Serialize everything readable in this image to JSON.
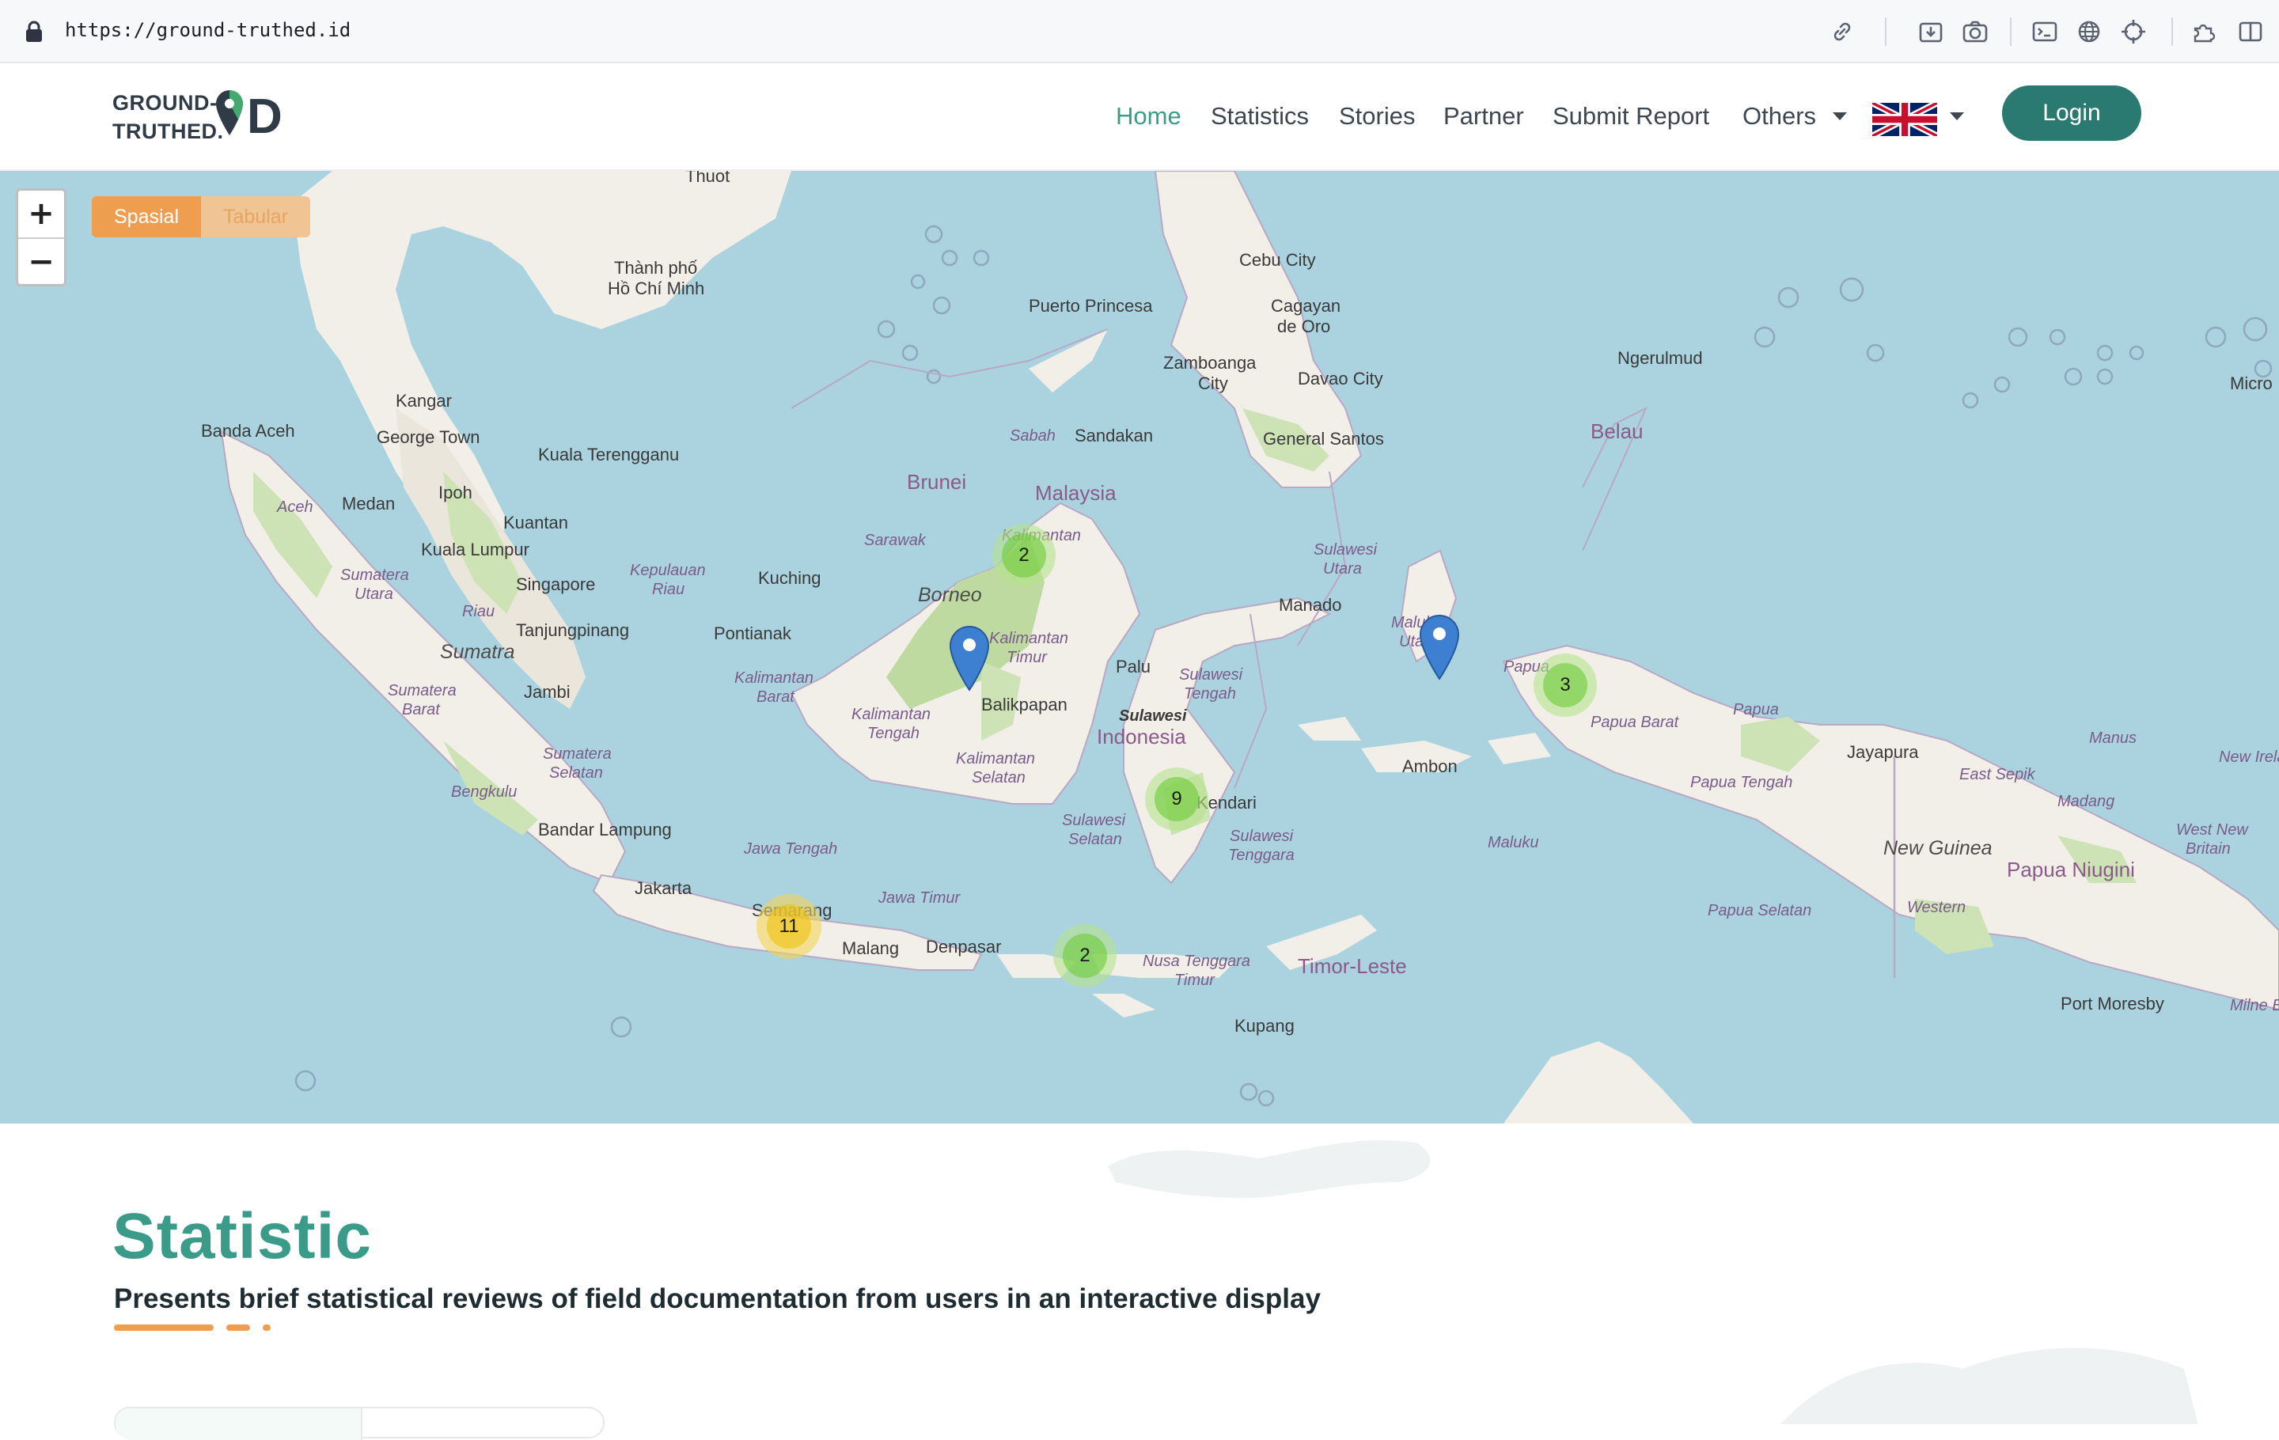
{
  "browser": {
    "url": "https://ground-truthed.id"
  },
  "site": {
    "logo_line1": "GROUND-",
    "logo_line2": "TRUTHED.",
    "logo_mark": "D"
  },
  "nav": {
    "items": [
      {
        "label": "Home",
        "active": true
      },
      {
        "label": "Statistics"
      },
      {
        "label": "Stories"
      },
      {
        "label": "Partner"
      },
      {
        "label": "Submit Report"
      },
      {
        "label": "Others"
      }
    ],
    "language": "English (UK flag)",
    "login_label": "Login"
  },
  "map": {
    "zoom_in": "+",
    "zoom_out": "−",
    "view_toggle": {
      "active": "Spasial",
      "inactive": "Tabular"
    },
    "clusters": [
      {
        "count": "2",
        "color": "green"
      },
      {
        "count": "3",
        "color": "green"
      },
      {
        "count": "9",
        "color": "green"
      },
      {
        "count": "11",
        "color": "yellow"
      },
      {
        "count": "2",
        "color": "green"
      }
    ],
    "labels": {
      "thuot": "Thuot",
      "hcmc1": "Thành phố",
      "hcmc2": "Hồ Chí Minh",
      "cebu": "Cebu City",
      "cagayan1": "Cagayan",
      "cagayan2": "de Oro",
      "puerto": "Puerto Princesa",
      "zamboanga1": "Zamboanga",
      "zamboanga2": "City",
      "davao": "Davao City",
      "gensan": "General Santos",
      "ngerulmud": "Ngerulmud",
      "belau": "Belau",
      "micro": "Micro",
      "banda": "Banda Aceh",
      "kangar": "Kangar",
      "georgetown": "George Town",
      "kualat": "Kuala Terengganu",
      "ipoh": "Ipoh",
      "kuantan": "Kuantan",
      "kl": "Kuala Lumpur",
      "medan": "Medan",
      "aceh": "Aceh",
      "sumut1": "Sumatera",
      "sumut2": "Utara",
      "singapore": "Singapore",
      "riau": "Riau",
      "kepri1": "Kepulauan",
      "kepri2": "Riau",
      "tanjung": "Tanjungpinang",
      "sumatra": "Sumatra",
      "jambi": "Jambi",
      "sumbar1": "Sumatera",
      "sumbar2": "Barat",
      "sumsel1": "Sumatera",
      "sumsel2": "Selatan",
      "bengkulu": "Bengkulu",
      "lampung": "Bandar Lampung",
      "sabah": "Sabah",
      "sandakan": "Sandakan",
      "brunei": "Brunei",
      "malaysia": "Malaysia",
      "sarawak": "Sarawak",
      "kuching": "Kuching",
      "borneo": "Borneo",
      "pontianak": "Pontianak",
      "kalbar1": "Kalimantan",
      "kalbar2": "Barat",
      "kalteng1": "Kalimantan",
      "kalteng2": "Tengah",
      "kaltim1": "Kalimantan",
      "kaltim2": "Timur",
      "kalsel1": "Kalimantan",
      "kalsel2": "Selatan",
      "balikpapan": "Balikpapan",
      "kaltara": "Kalimantan",
      "manado": "Manado",
      "sulut1": "Sulawesi",
      "sulut2": "Utara",
      "palu": "Palu",
      "sulteng1": "Sulawesi",
      "sulteng2": "Tengah",
      "sulawesi": "Sulawesi",
      "indonesia": "Indonesia",
      "sulsel1": "Sulawesi",
      "sulsel2": "Selatan",
      "kendari": "Kendari",
      "sultra1": "Sulawesi",
      "sultra2": "Tenggara",
      "malut1": "Maluku",
      "malut2": "Utara",
      "ambon": "Ambon",
      "maluku": "Maluku",
      "papua_b": "Papua",
      "papua_barat": "Papua Barat",
      "papua": "Papua",
      "jayapura": "Jayapura",
      "papua_tengah": "Papua Tengah",
      "newguinea": "New Guinea",
      "papua_selatan": "Papua Selatan",
      "western": "Western",
      "eastsepik": "East Sepik",
      "madang": "Madang",
      "manus": "Manus",
      "newireland": "New Irela",
      "westnewbritain1": "West New",
      "westnewbritain2": "Britain",
      "png": "Papua Niugini",
      "portmoresby": "Port Moresby",
      "milnebay": "Milne B",
      "jakarta": "Jakarta",
      "jateng": "Jawa Tengah",
      "semarang": "Semarang",
      "jatim": "Jawa Timur",
      "malang": "Malang",
      "denpasar": "Denpasar",
      "ntt1": "Nusa Tenggara",
      "ntt2": "Timur",
      "timorleste": "Timor-Leste",
      "kupang": "Kupang"
    }
  },
  "statistic": {
    "title": "Statistic",
    "subtitle": "Presents brief statistical reviews of field documentation from users in an interactive display"
  },
  "colors": {
    "brand_green": "#3a9c88",
    "login_bg": "#2b7a71",
    "accent_orange": "#ef9e50",
    "sea": "#aad3df"
  }
}
